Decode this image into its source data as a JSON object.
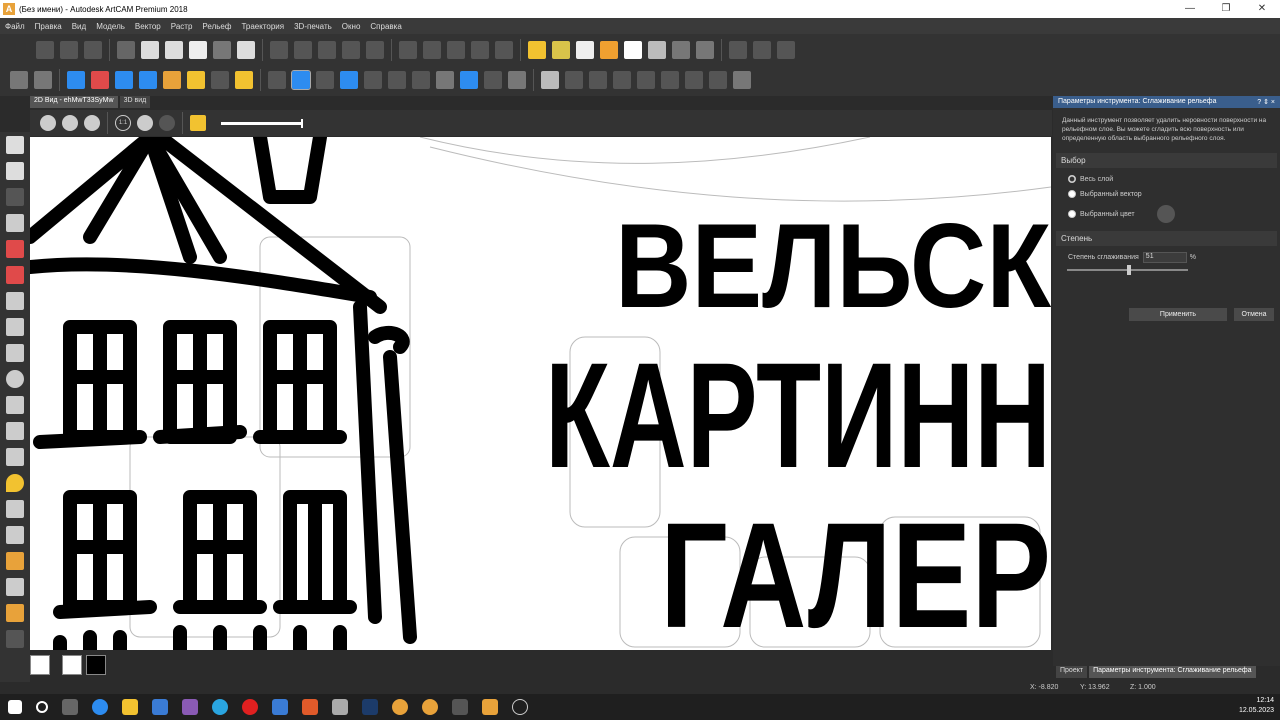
{
  "window": {
    "title": "(Без имени) - Autodesk ArtCAM Premium 2018",
    "logo_letter": "A",
    "min": "—",
    "max": "❐",
    "close": "✕"
  },
  "menu": [
    "Файл",
    "Правка",
    "Вид",
    "Модель",
    "Вектор",
    "Растр",
    "Рельеф",
    "Траектория",
    "3D-печать",
    "Окно",
    "Справка"
  ],
  "tabs": {
    "tab2d": "2D Вид - ehMwT33SyMw",
    "tab3d": "3D вид"
  },
  "view_toolbar": {
    "fit_label": "1:1"
  },
  "canvas_text": {
    "line1": "ВЕЛЬСК",
    "line2": "КАРТИНН",
    "line3": "ГАЛЕР"
  },
  "panel": {
    "header": "Параметры инструмента: Сглаживание рельефа",
    "header_icons": "? ⇕ ×",
    "description": "Данный инструмент позволяет удалить неровности поверхности на рельефном слое. Вы можете сгладить всю поверхность или определенную область выбранного рельефного слоя.",
    "selection_title": "Выбор",
    "options": [
      {
        "label": "Весь слой",
        "selected": true
      },
      {
        "label": "Выбранный вектор",
        "selected": false
      },
      {
        "label": "Выбранный цвет",
        "selected": false
      }
    ],
    "degree_title": "Степень",
    "smoothing_label": "Степень сглаживания",
    "smoothing_value": "51",
    "smoothing_unit": "%",
    "smoothing_fraction": 0.51,
    "apply": "Применить",
    "cancel": "Отмена"
  },
  "bottom_tabs": {
    "project": "Проект",
    "params": "Параметры инструмента: Сглаживание рельефа"
  },
  "status": {
    "x": "X: -8.820",
    "y": "Y: 13.962",
    "z": "Z: 1.000"
  },
  "clock": {
    "time": "12:14",
    "date": "12.05.2023"
  },
  "colors": {
    "accent": "#3a5e8c",
    "toolbar_blue": "#2d8cf0",
    "yellow": "#f2c230"
  }
}
